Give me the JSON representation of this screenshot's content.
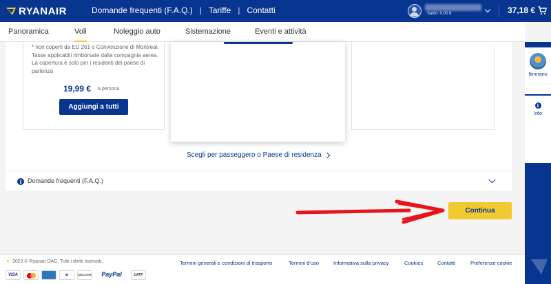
{
  "header": {
    "logo": "RYANAIR",
    "nav": [
      "Domande frequenti (F.A.Q.)",
      "Tariffe",
      "Contatti"
    ],
    "balance": "Saldo: 0,00 €",
    "total_price": "37,18 €",
    "icons": [
      "harp-logo-icon",
      "user-avatar-icon",
      "chevron-down-icon",
      "cart-icon"
    ]
  },
  "subnav": {
    "tabs": [
      "Panoramica",
      "Voli",
      "Noleggio auto",
      "Sistemazione",
      "Eventi e attività"
    ],
    "active": "Voli"
  },
  "content": {
    "note": "* non coperti da EU 261 o Convenzione di Montreal. Tasse applicabili rimborsate dalla compagnia aerea. La copertura è solo per i residenti del paese di partenza",
    "amount": "19,99 €",
    "per_person": "a persona",
    "add_all_button": "Aggiungi a tutti",
    "choose_link": "Scegli per passeggero o Paese di residenza",
    "faq_label": "Domande frequenti (F.A.Q.)",
    "continue_button": "Continua"
  },
  "sidebar": {
    "itinerary": "Itinerario",
    "info": "Info"
  },
  "footer": {
    "copyright": "2022 © Ryanair DAC. Tutti i diritti riservati.",
    "links": [
      "Termini generali e condizioni di trasporto",
      "Termini d'uso",
      "Informativa sulla privacy",
      "Cookies",
      "Contatti",
      "Preferenze cookie"
    ],
    "payments": [
      "VISA",
      "mastercard",
      "AMEX",
      "Diners",
      "DISCOVER",
      "PayPal",
      "UATP"
    ]
  },
  "colors": {
    "brand_blue": "#073590",
    "accent_yellow": "#f1c931",
    "annotation_red": "#e8141b"
  }
}
